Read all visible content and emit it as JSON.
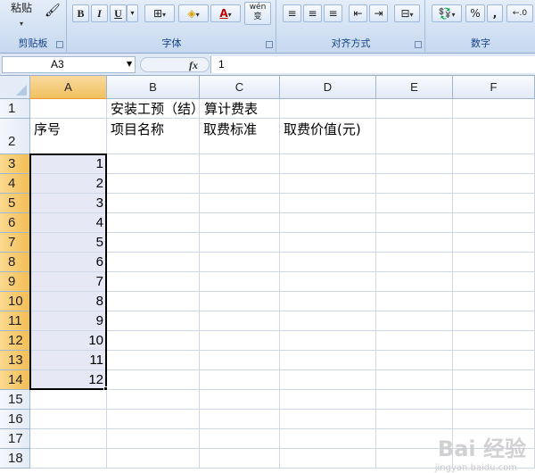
{
  "ribbon": {
    "clipboard": {
      "paste_label": "粘贴",
      "group_label": "剪贴板"
    },
    "font": {
      "group_label": "字体",
      "bold": "B",
      "italic": "I",
      "underline": "U",
      "font_color": "A",
      "phonetic": "wén 变"
    },
    "alignment": {
      "group_label": "对齐方式"
    },
    "number": {
      "group_label": "数字",
      "percent": "%",
      "comma": ","
    }
  },
  "formula_bar": {
    "name_box": "A3",
    "fx": "fx",
    "value": "1"
  },
  "columns": [
    "A",
    "B",
    "C",
    "D",
    "E",
    "F"
  ],
  "rows": [
    "1",
    "2",
    "3",
    "4",
    "5",
    "6",
    "7",
    "8",
    "9",
    "10",
    "11",
    "12",
    "13",
    "14",
    "15",
    "16",
    "17",
    "18"
  ],
  "cells": {
    "title": "安装工预（结）算计费表",
    "header_a": "序号",
    "header_b": "项目名称",
    "header_c": "取费标准",
    "header_d": "取费价值(元)",
    "seq": [
      "1",
      "2",
      "3",
      "4",
      "5",
      "6",
      "7",
      "8",
      "9",
      "10",
      "11",
      "12"
    ]
  },
  "watermark": {
    "text": "Bai 经验",
    "sub": "jingyan.baidu.com"
  },
  "colors": {
    "selection_header": "#f3bd55",
    "selection_fill": "#e6e8f6",
    "ribbon": "#dbe6f5"
  }
}
